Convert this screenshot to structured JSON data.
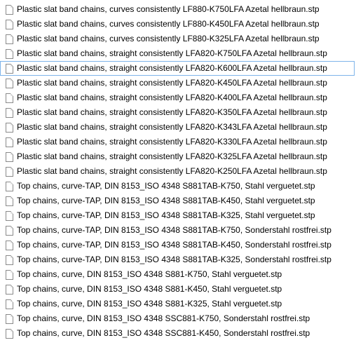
{
  "files": [
    {
      "name": "Plastic slat band chains, curves consistently LF880-K750LFA Azetal hellbraun.stp",
      "focused": false
    },
    {
      "name": "Plastic slat band chains, curves consistently LF880-K450LFA Azetal hellbraun.stp",
      "focused": false
    },
    {
      "name": "Plastic slat band chains, curves consistently LF880-K325LFA Azetal hellbraun.stp",
      "focused": false
    },
    {
      "name": "Plastic slat band chains, straight consistently LFA820-K750LFA Azetal hellbraun.stp",
      "focused": false
    },
    {
      "name": "Plastic slat band chains, straight consistently LFA820-K600LFA Azetal hellbraun.stp",
      "focused": true
    },
    {
      "name": "Plastic slat band chains, straight consistently LFA820-K450LFA Azetal hellbraun.stp",
      "focused": false
    },
    {
      "name": "Plastic slat band chains, straight consistently LFA820-K400LFA Azetal hellbraun.stp",
      "focused": false
    },
    {
      "name": "Plastic slat band chains, straight consistently LFA820-K350LFA Azetal hellbraun.stp",
      "focused": false
    },
    {
      "name": "Plastic slat band chains, straight consistently LFA820-K343LFA Azetal hellbraun.stp",
      "focused": false
    },
    {
      "name": "Plastic slat band chains, straight consistently LFA820-K330LFA Azetal hellbraun.stp",
      "focused": false
    },
    {
      "name": "Plastic slat band chains, straight consistently LFA820-K325LFA Azetal hellbraun.stp",
      "focused": false
    },
    {
      "name": "Plastic slat band chains, straight consistently LFA820-K250LFA Azetal hellbraun.stp",
      "focused": false
    },
    {
      "name": "Top chains, curve-TAP, DIN 8153_ISO 4348 S881TAB-K750, Stahl verguetet.stp",
      "focused": false
    },
    {
      "name": "Top chains, curve-TAP, DIN 8153_ISO 4348 S881TAB-K450, Stahl verguetet.stp",
      "focused": false
    },
    {
      "name": "Top chains, curve-TAP, DIN 8153_ISO 4348 S881TAB-K325, Stahl verguetet.stp",
      "focused": false
    },
    {
      "name": "Top chains, curve-TAP, DIN 8153_ISO 4348 S881TAB-K750, Sonderstahl rostfrei.stp",
      "focused": false
    },
    {
      "name": "Top chains, curve-TAP, DIN 8153_ISO 4348 S881TAB-K450, Sonderstahl rostfrei.stp",
      "focused": false
    },
    {
      "name": "Top chains, curve-TAP, DIN 8153_ISO 4348 S881TAB-K325, Sonderstahl rostfrei.stp",
      "focused": false
    },
    {
      "name": "Top chains, curve, DIN 8153_ISO 4348 S881-K750, Stahl verguetet.stp",
      "focused": false
    },
    {
      "name": "Top chains, curve, DIN 8153_ISO 4348 S881-K450, Stahl verguetet.stp",
      "focused": false
    },
    {
      "name": "Top chains, curve, DIN 8153_ISO 4348 S881-K325, Stahl verguetet.stp",
      "focused": false
    },
    {
      "name": "Top chains, curve, DIN 8153_ISO 4348 SSC881-K750, Sonderstahl rostfrei.stp",
      "focused": false
    },
    {
      "name": "Top chains, curve, DIN 8153_ISO 4348 SSC881-K450, Sonderstahl rostfrei.stp",
      "focused": false
    }
  ],
  "icon": "document-icon",
  "colors": {
    "focus_border": "#7eb4ea",
    "icon_border": "#8a8a8a",
    "text": "#000000"
  }
}
